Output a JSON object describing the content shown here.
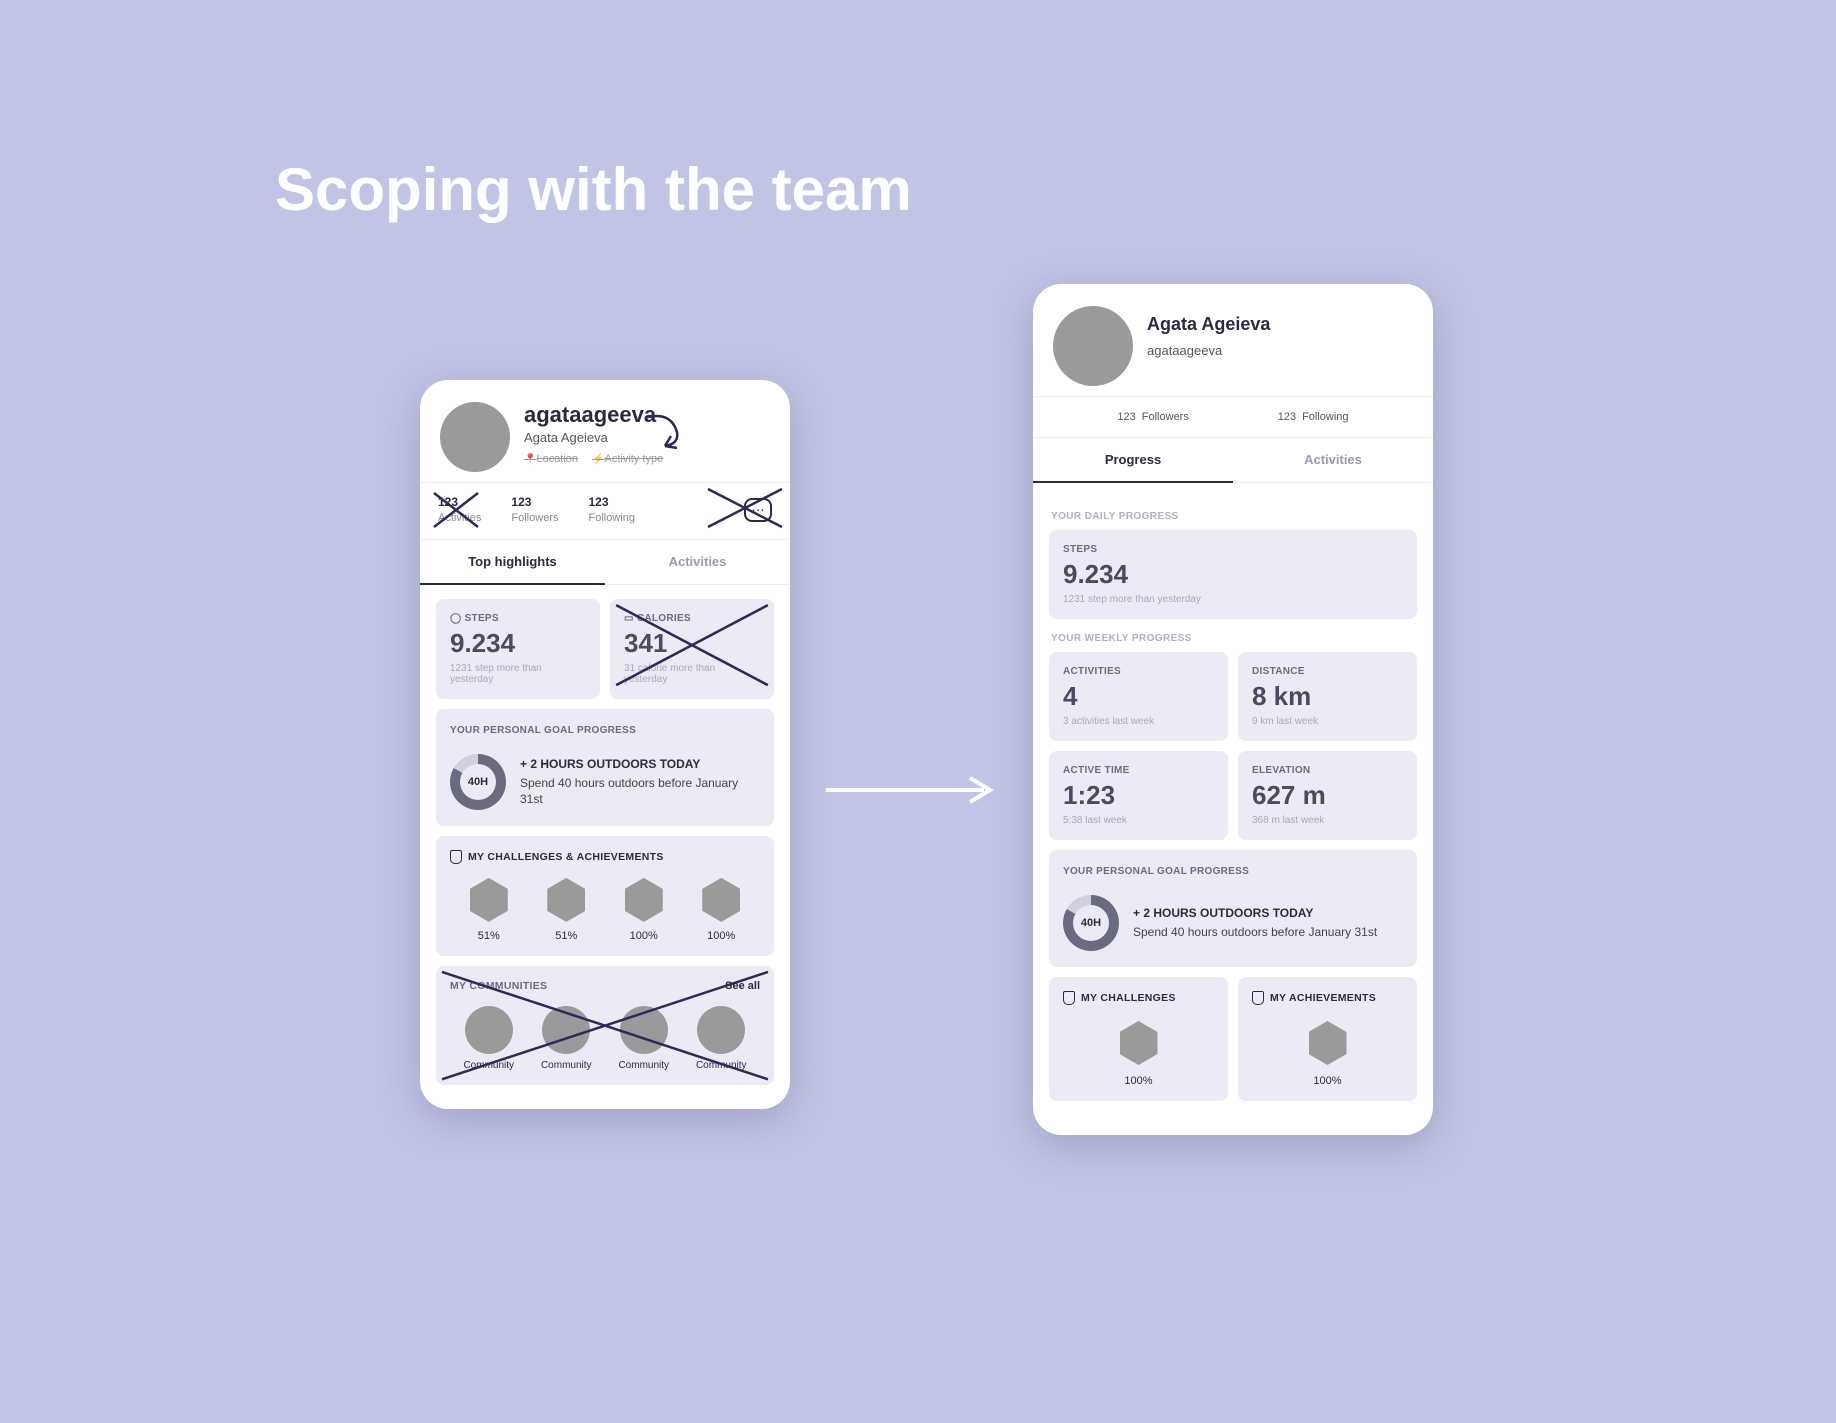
{
  "pageTitle": "Scoping with the team",
  "left": {
    "handle": "agataageeva",
    "name": "Agata Ageieva",
    "meta": {
      "location": "Location",
      "activity": "Activity type"
    },
    "stats": {
      "activities": {
        "n": "123",
        "l": "Activities"
      },
      "followers": {
        "n": "123",
        "l": "Followers"
      },
      "following": {
        "n": "123",
        "l": "Following"
      }
    },
    "tabs": {
      "highlights": "Top highlights",
      "activities": "Activities"
    },
    "steps": {
      "label": "STEPS",
      "value": "9.234",
      "sub": "1231 step more than yesterday"
    },
    "calories": {
      "label": "CALORIES",
      "value": "341",
      "sub": "31 calorie more than yesterday"
    },
    "goal": {
      "section": "YOUR PERSONAL GOAL PROGRESS",
      "ring": "40H",
      "title": "+ 2 HOURS OUTDOORS TODAY",
      "desc": "Spend 40 hours outdoors before January 31st"
    },
    "challenges": {
      "label": "MY CHALLENGES & ACHIEVEMENTS",
      "items": [
        "51%",
        "51%",
        "100%",
        "100%"
      ]
    },
    "communities": {
      "label": "MY COMMUNITIES",
      "seeall": "See all",
      "items": [
        "Community",
        "Community",
        "Community",
        "Community"
      ]
    }
  },
  "right": {
    "name": "Agata Ageieva",
    "handle": "agataageeva",
    "stats": {
      "followers": {
        "n": "123",
        "l": "Followers"
      },
      "following": {
        "n": "123",
        "l": "Following"
      }
    },
    "tabs": {
      "progress": "Progress",
      "activities": "Activities"
    },
    "daily": {
      "section": "YOUR DAILY PROGRESS",
      "steps": {
        "label": "STEPS",
        "value": "9.234",
        "sub": "1231 step more than yesterday"
      }
    },
    "weekly": {
      "section": "YOUR WEEKLY PROGRESS",
      "activities": {
        "label": "ACTIVITIES",
        "value": "4",
        "sub": "3 activities last week"
      },
      "distance": {
        "label": "DISTANCE",
        "value": "8 km",
        "sub": "9 km last week"
      },
      "activeTime": {
        "label": "ACTIVE TIME",
        "value": "1:23",
        "sub": "5:38 last week"
      },
      "elevation": {
        "label": "ELEVATION",
        "value": "627 m",
        "sub": "368 m last week"
      }
    },
    "goal": {
      "section": "YOUR PERSONAL GOAL PROGRESS",
      "ring": "40H",
      "title": "+ 2 HOURS OUTDOORS TODAY",
      "desc": "Spend 40 hours outdoors before January 31st"
    },
    "challenges": {
      "label": "MY CHALLENGES",
      "pct": "100%"
    },
    "achievements": {
      "label": "MY ACHIEVEMENTS",
      "pct": "100%"
    }
  }
}
